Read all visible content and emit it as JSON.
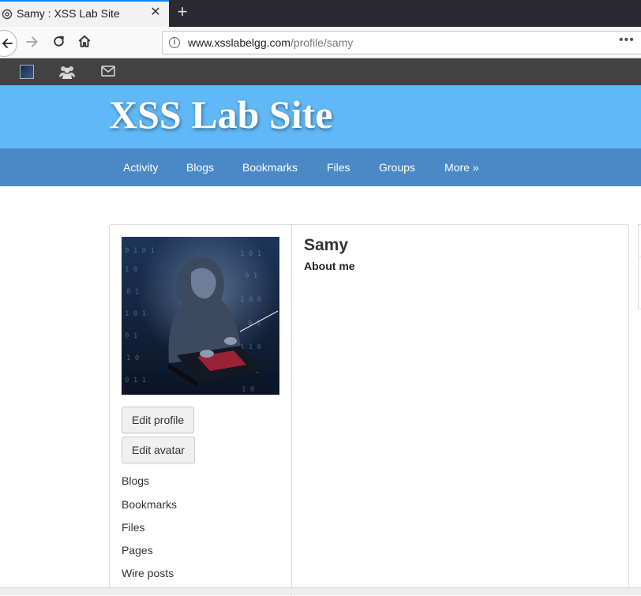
{
  "browser": {
    "tab_title": "Samy : XSS Lab Site",
    "tab_close": "✕",
    "new_tab": "+",
    "url_domain": "www.xsslabelgg.com",
    "url_path": "/profile/samy",
    "url_more": "•••",
    "info_icon": "i"
  },
  "site": {
    "title": "XSS Lab Site"
  },
  "menu": {
    "items": [
      "Activity",
      "Blogs",
      "Bookmarks",
      "Files",
      "Groups",
      "More »"
    ]
  },
  "profile": {
    "name": "Samy",
    "about_label": "About me",
    "edit_profile": "Edit profile",
    "edit_avatar": "Edit avatar",
    "links": [
      "Blogs",
      "Bookmarks",
      "Files",
      "Pages",
      "Wire posts"
    ]
  },
  "icons": {
    "tab_favicon": "settings-gear-icon",
    "topbar_friends": "friends-icon",
    "topbar_messages": "envelope-icon"
  },
  "colors": {
    "header_bg": "#60b8f7",
    "menu_bg": "#4a89c6",
    "topbar_bg": "#424242",
    "tab_accent": "#0a84ff"
  }
}
